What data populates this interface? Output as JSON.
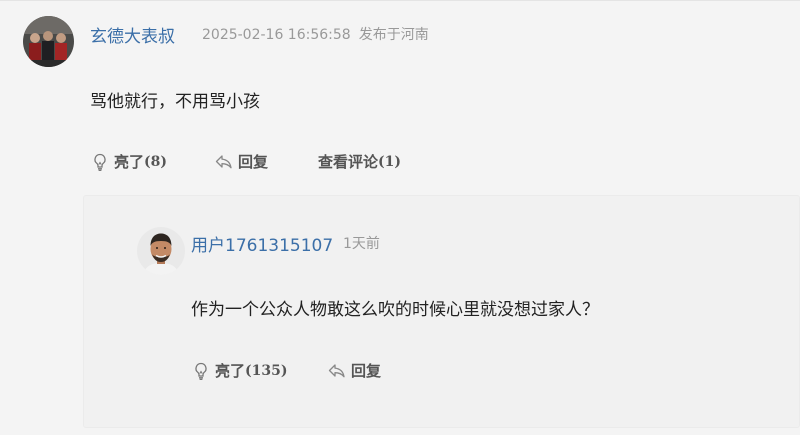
{
  "comment": {
    "username": "玄德大表叔",
    "timestamp": "2025-02-16 16:56:58",
    "location": "发布于河南",
    "text": "骂他就行，不用骂小孩",
    "actions": {
      "like_label": "亮了",
      "like_count": "(8)",
      "reply_label": "回复",
      "view_replies_label": "查看评论",
      "view_replies_count": "(1)"
    }
  },
  "reply": {
    "username": "用户1761315107",
    "time": "1天前",
    "text": "作为一个公众人物敢这么吹的时候心里就没想过家人？",
    "actions": {
      "like_label": "亮了",
      "like_count": "(135)",
      "reply_label": "回复"
    }
  },
  "icons": {
    "like": "lightbulb-icon",
    "reply": "reply-arrow-icon"
  },
  "colors": {
    "username": "#3b6fa8",
    "meta": "#999999",
    "background": "#f4f4f4",
    "reply_background": "#f1f1f1"
  }
}
